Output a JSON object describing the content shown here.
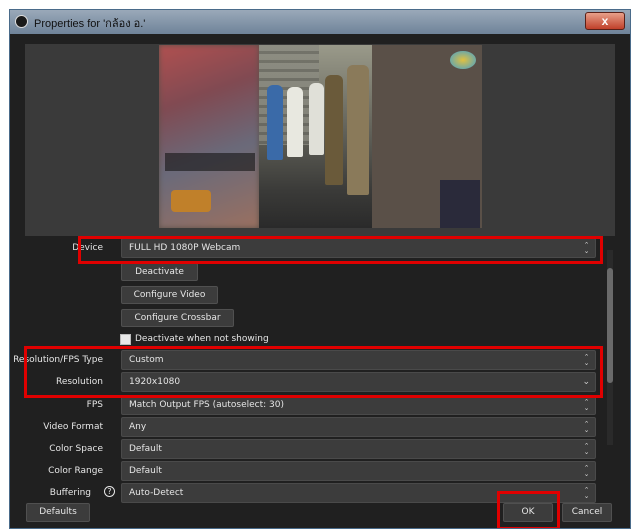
{
  "window": {
    "title": "Properties for 'กล้อง อ.'",
    "close_label": "x"
  },
  "properties": [
    {
      "label": "Device",
      "value": "FULL HD 1080P Webcam",
      "control": "spin"
    },
    {
      "label": "Resolution/FPS Type",
      "value": "Custom",
      "control": "spin"
    },
    {
      "label": "Resolution",
      "value": "1920x1080",
      "control": "chevron"
    },
    {
      "label": "FPS",
      "value": "Match Output FPS (autoselect: 30)",
      "control": "spin"
    },
    {
      "label": "Video Format",
      "value": "Any",
      "control": "spin"
    },
    {
      "label": "Color Space",
      "value": "Default",
      "control": "spin"
    },
    {
      "label": "Color Range",
      "value": "Default",
      "control": "spin"
    },
    {
      "label": "Buffering",
      "value": "Auto-Detect",
      "control": "spin"
    }
  ],
  "buttons": {
    "deactivate": "Deactivate",
    "configure_video": "Configure Video",
    "configure_crossbar": "Configure Crossbar",
    "defaults": "Defaults",
    "ok": "OK",
    "cancel": "Cancel"
  },
  "checkbox": {
    "label": "Deactivate when not showing",
    "checked": true
  },
  "icons": {
    "spin": "⌃⌄",
    "chevron": "⌄",
    "help": "?",
    "title": "obs-logo-icon"
  },
  "colors": {
    "highlight": "#e00000",
    "panel": "#202020",
    "field": "#3c3c3c"
  }
}
